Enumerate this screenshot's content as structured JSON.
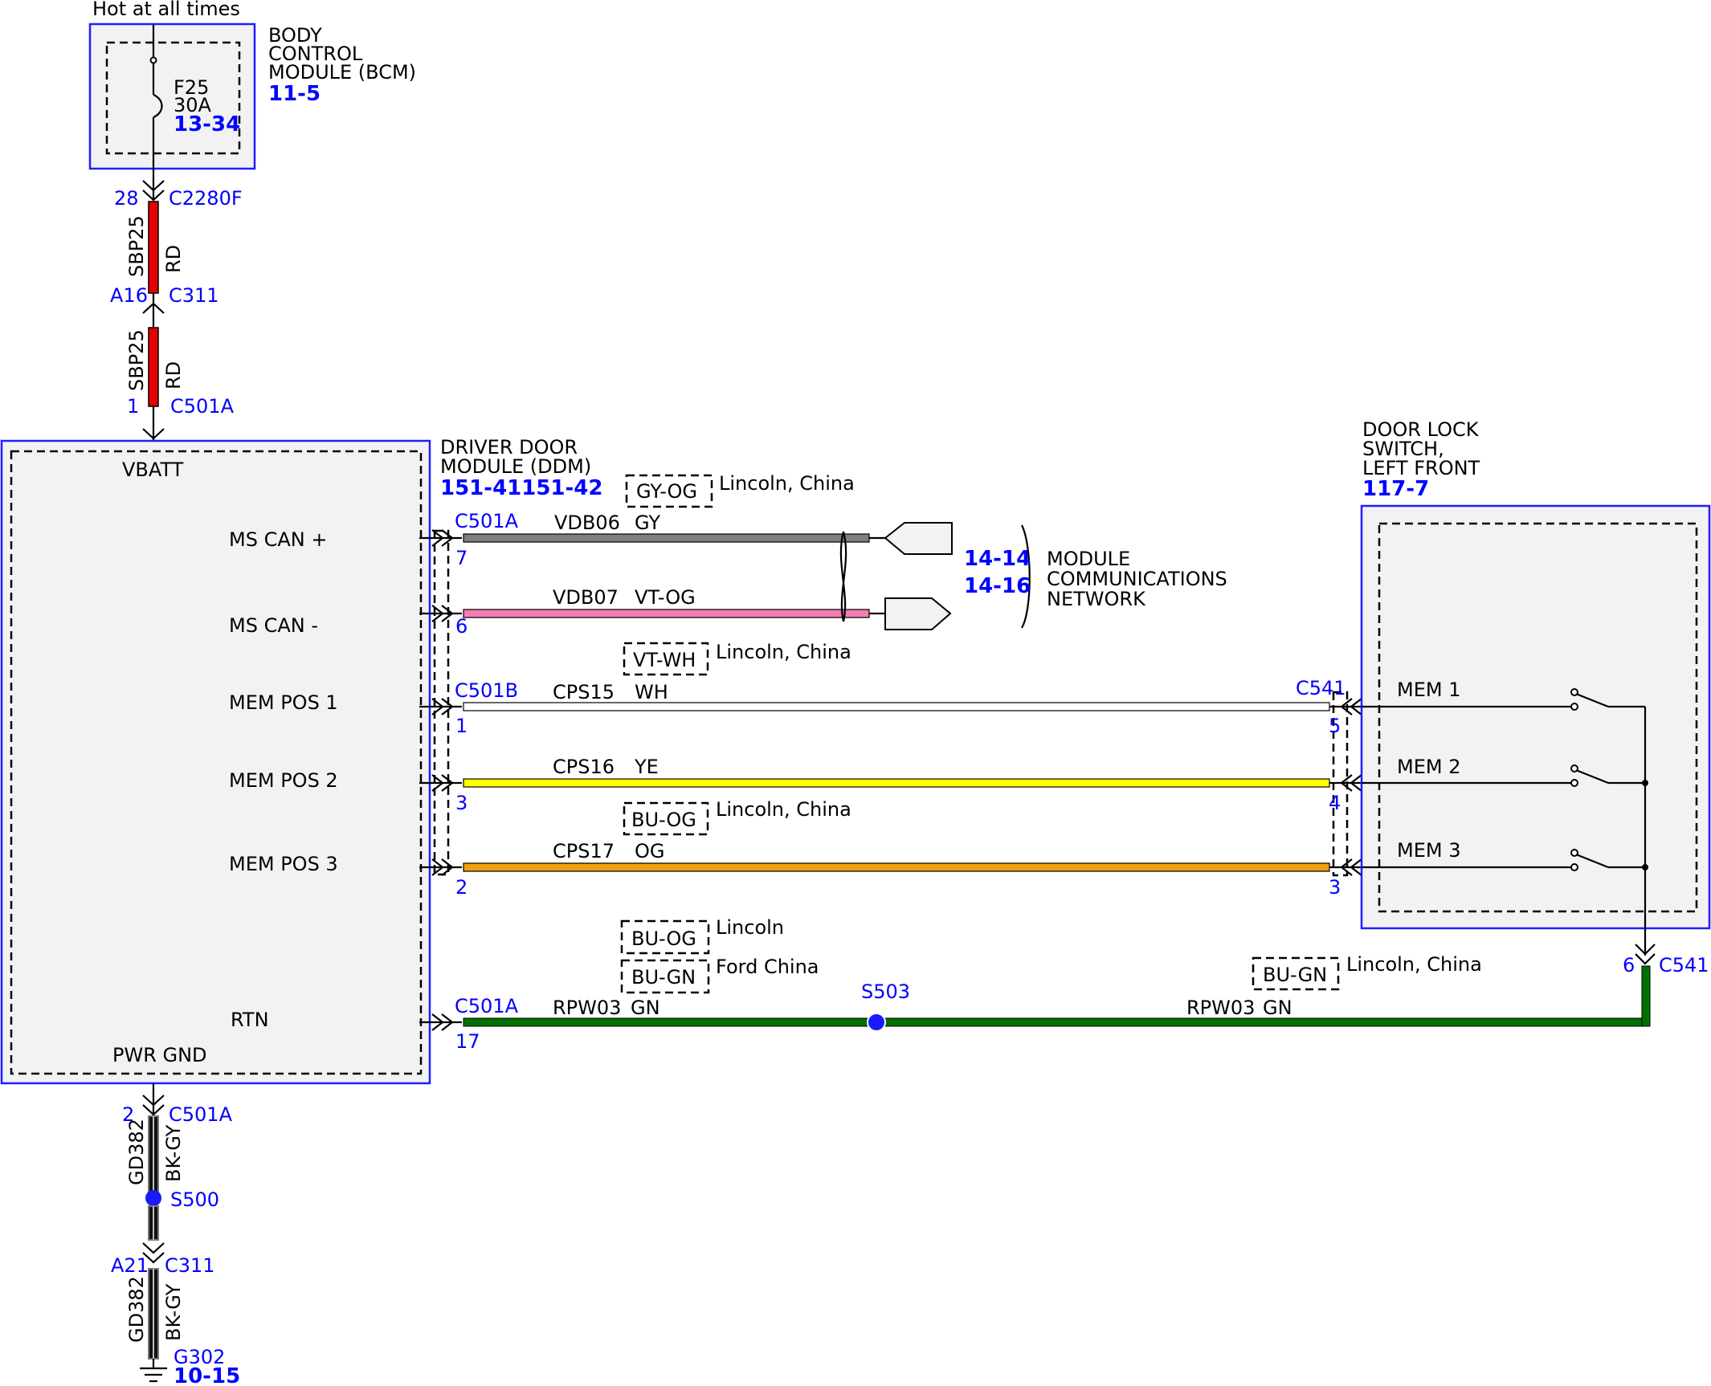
{
  "top": {
    "hot_label": "Hot at all times"
  },
  "bcm": {
    "title_lines": [
      "BODY",
      "CONTROL",
      "MODULE (BCM)"
    ],
    "ref": "11-5",
    "fuse_name": "F25",
    "fuse_rating": "30A",
    "fuse_ref": "13-34"
  },
  "bcm_wire": {
    "pin": "28",
    "connector": "C2280F",
    "circuit": "SBP25",
    "color": "RD"
  },
  "c311_top": {
    "pin": "A16",
    "connector": "C311"
  },
  "ddm_feed": {
    "circuit": "SBP25",
    "color": "RD",
    "pin": "1",
    "connector": "C501A"
  },
  "ddm": {
    "title_lines": [
      "DRIVER DOOR",
      "MODULE (DDM)"
    ],
    "ref": "151-41151-42",
    "vbatt": "VBATT",
    "pins": [
      "MS CAN +",
      "MS CAN -",
      "MEM POS 1",
      "MEM POS 2",
      "MEM POS 3",
      "RTN"
    ],
    "pwr_gnd": "PWR GND"
  },
  "wires": [
    {
      "connector": "C501A",
      "pin": "7",
      "circuit": "VDB06",
      "color": "GY",
      "hex": "#7f7f7f"
    },
    {
      "connector": "",
      "pin": "6",
      "circuit": "VDB07",
      "color": "VT-OG",
      "hex": "#f07fb4"
    },
    {
      "connector": "C501B",
      "pin": "1",
      "circuit": "CPS15",
      "color": "WH",
      "hex": "#ffffff",
      "far_connector": "C541",
      "far_pin": "5"
    },
    {
      "connector": "",
      "pin": "3",
      "circuit": "CPS16",
      "color": "YE",
      "hex": "#ffff00",
      "far_pin": "4"
    },
    {
      "connector": "",
      "pin": "2",
      "circuit": "CPS17",
      "color": "OG",
      "hex": "#f0a010",
      "far_pin": "3"
    },
    {
      "connector": "C501A",
      "pin": "17",
      "circuit": "RPW03",
      "color": "GN",
      "hex": "#007000"
    }
  ],
  "variants": {
    "gy_og": {
      "code": "GY-OG",
      "note": "Lincoln, China"
    },
    "vt_wh": {
      "code": "VT-WH",
      "note": "Lincoln, China"
    },
    "bu_og": {
      "code": "BU-OG",
      "note": "Lincoln, China"
    },
    "bu_og_lincoln": {
      "code": "BU-OG",
      "note": "Lincoln"
    },
    "bu_gn_ford": {
      "code": "BU-GN",
      "note": "Ford China"
    },
    "bu_gn_right": {
      "code": "BU-GN",
      "note": "Lincoln, China"
    }
  },
  "network": {
    "refs": [
      "14-14",
      "14-16"
    ],
    "label_lines": [
      "MODULE",
      "COMMUNICATIONS",
      "NETWORK"
    ]
  },
  "door_switch": {
    "title_lines": [
      "DOOR LOCK",
      "SWITCH,",
      "LEFT FRONT"
    ],
    "ref": "117-7",
    "contacts": [
      "MEM 1",
      "MEM 2",
      "MEM 3"
    ]
  },
  "splice_s503": {
    "name": "S503",
    "circuit_right": "RPW03",
    "color_right": "GN"
  },
  "c541_bottom": {
    "pin": "6",
    "connector": "C541"
  },
  "ground": {
    "pin": "2",
    "connector": "C501A",
    "circuit": "GD382",
    "color": "BK-GY",
    "splice": "S500",
    "c311_pin": "A21",
    "c311": "C311",
    "circuit2": "GD382",
    "color2": "BK-GY",
    "ground_id": "G302",
    "ground_ref": "10-15"
  },
  "colors": {
    "link": "#0000ff",
    "module_border": "#1f1fff",
    "module_fill": "#f2f2f2"
  }
}
